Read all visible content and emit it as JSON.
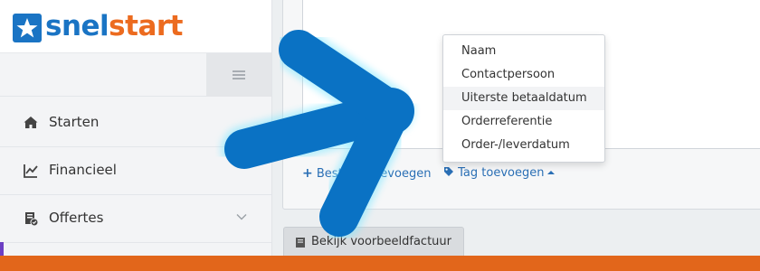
{
  "brand": {
    "name_part1": "snel",
    "name_part2": "start",
    "primary_color": "#1a74c4",
    "accent_color": "#ec6b1f"
  },
  "sidebar": {
    "items": [
      {
        "label": "Starten",
        "icon": "home-icon"
      },
      {
        "label": "Financieel",
        "icon": "line-chart-icon"
      },
      {
        "label": "Offertes",
        "icon": "quote-document-icon",
        "expandable": true
      }
    ]
  },
  "editor": {
    "add_field_label": "Bestand toevoegen",
    "tag_add_label": "Tag toevoegen"
  },
  "tag_dropdown": {
    "items": [
      "Naam",
      "Contactpersoon",
      "Uiterste betaaldatum",
      "Orderreferentie",
      "Order-/leverdatum"
    ],
    "highlighted": "Uiterste betaaldatum"
  },
  "preview_button": {
    "label": "Bekijk voorbeeldfactuur"
  },
  "overlay": {
    "arrow_color": "#0a72c4"
  }
}
